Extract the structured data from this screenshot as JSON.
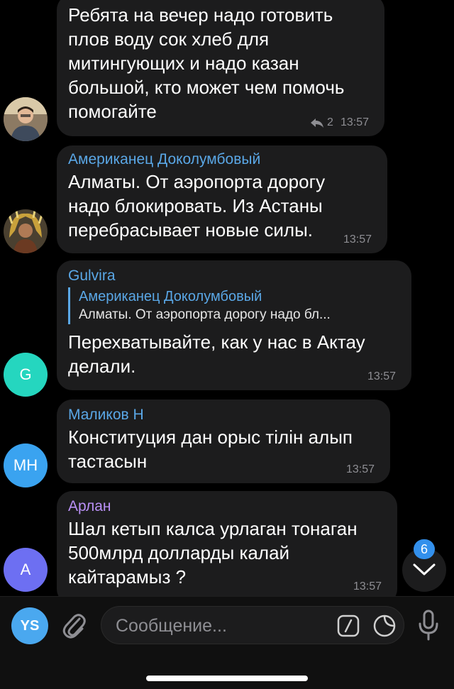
{
  "messages": [
    {
      "sender": "",
      "text": "Ребята на вечер надо готовить плов воду сок хлеб для митингующих и надо казан большой, кто может чем помочь помогайте",
      "lines": [
        "Ребята на вечер надо готовить",
        "плов воду сок хлеб для",
        "митингующих и надо казан",
        "большой, кто может чем помочь",
        "помогайте"
      ],
      "replies": "2",
      "time": "13:57",
      "avatar": "photo"
    },
    {
      "sender": "Американец Доколумбовый",
      "sender_color": "#5aa7e6",
      "lines": [
        "Алматы. От аэропорта дорогу",
        "надо блокировать. Из Астаны",
        "перебрасывает новые силы."
      ],
      "time": "13:57",
      "avatar": "photo"
    },
    {
      "sender": "Gulvira",
      "sender_color": "#5aa7e6",
      "quote_name": "Американец Доколумбовый",
      "quote_text": "Алматы. От аэропорта дорогу надо бл...",
      "lines": [
        "Перехватывайте, как у нас в Актау",
        "делали."
      ],
      "time": "13:57",
      "avatar_initials": "G",
      "avatar_color": "#25d6bf"
    },
    {
      "sender": "Маликов Н",
      "sender_color": "#5aa7e6",
      "lines": [
        "Конституция дан орыс тілін алып",
        "тастасын"
      ],
      "time": "13:57",
      "avatar_initials": "MH",
      "avatar_color": "#3aa3f0"
    },
    {
      "sender": "Арлан",
      "sender_color": "#b990f5",
      "lines": [
        "Шал кетып калса урлаган тонаган",
        "500млрд долларды калай",
        "кайтарамыз ?"
      ],
      "time": "13:57",
      "avatar_initials": "A",
      "avatar_color": "#6d6ff2"
    }
  ],
  "scroll_badge": "6",
  "input": {
    "user_initials": "YS",
    "placeholder": "Сообщение..."
  },
  "icons": {
    "attach": "paperclip-icon",
    "commands": "slash-command-icon",
    "sticker": "sticker-icon",
    "mic": "microphone-icon",
    "scroll": "chevron-down-icon",
    "reply": "reply-arrow-icon"
  }
}
